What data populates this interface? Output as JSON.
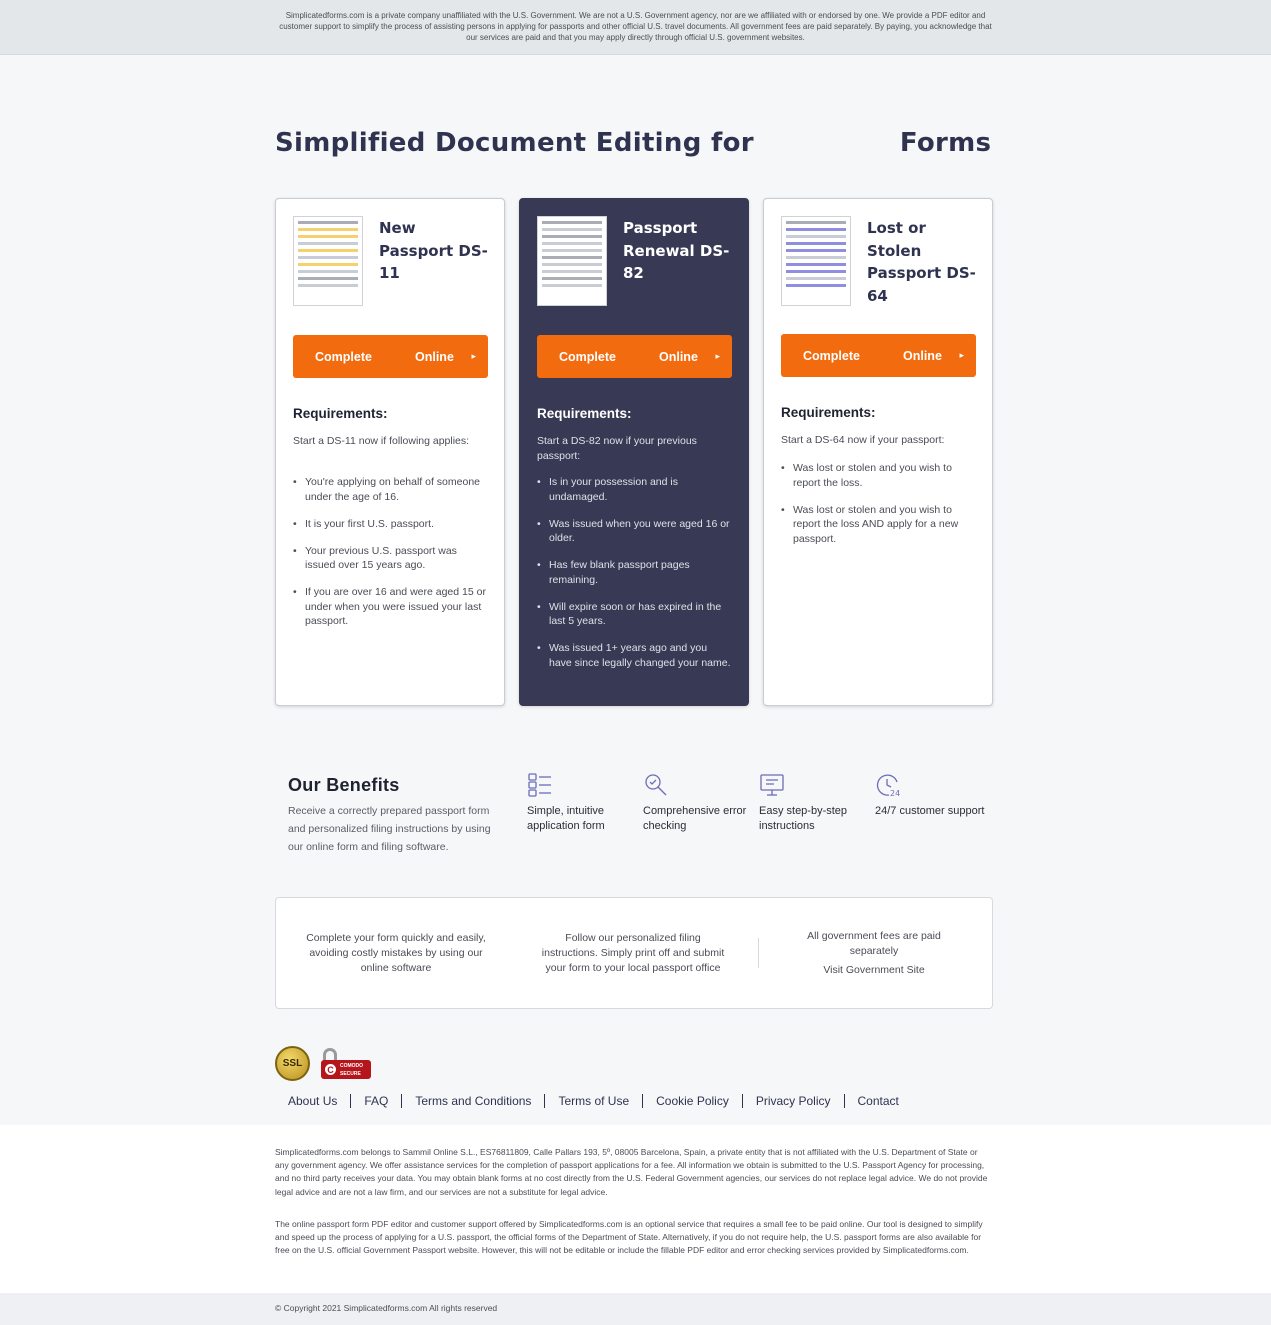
{
  "banner": {
    "text": "Simplicatedforms.com is a private company unaffiliated with the U.S. Government. We are not a U.S. Government agency, nor are we affiliated with or endorsed by one. We provide a PDF editor and customer support to simplify the process of assisting persons in applying for passports and other official U.S. travel documents. All government fees are paid separately. By paying, you acknowledge that our services are paid and that you may apply directly through official U.S. government websites."
  },
  "hero": {
    "title_left": "Simplified Document Editing for",
    "title_right": "Forms"
  },
  "cards": [
    {
      "title": "New Passport DS-11",
      "cta_word1": "Complete",
      "cta_word2": "Online",
      "cta_arrow": "▸",
      "req_title": "Requirements:",
      "req_intro": "Start a DS-11 now if following applies:",
      "items": [
        "You're applying on behalf of someone under the age of 16.",
        "It is your first U.S. passport.",
        "Your previous U.S. passport was issued over 15 years ago.",
        "If you are over 16 and were aged 15 or under when you were issued your last passport."
      ]
    },
    {
      "title": "Passport Renewal DS-82",
      "cta_word1": "Complete",
      "cta_word2": "Online",
      "cta_arrow": "▸",
      "req_title": "Requirements:",
      "req_intro": "Start a DS-82 now if your previous passport:",
      "items": [
        "Is in your possession and is undamaged.",
        "Was issued when you were aged 16 or older.",
        "Has few blank passport pages remaining.",
        "Will expire soon or has expired in the last 5 years.",
        "Was issued 1+ years ago and you have since legally changed your name."
      ]
    },
    {
      "title": "Lost or Stolen Passport DS-64",
      "cta_word1": "Complete",
      "cta_word2": "Online",
      "cta_arrow": "▸",
      "req_title": "Requirements:",
      "req_intro": "Start a DS-64 now if your passport:",
      "items": [
        "Was lost or stolen and you wish to report the loss.",
        "Was lost or stolen and you wish to report the loss AND apply for a new passport."
      ]
    }
  ],
  "benefits": {
    "title": "Our Benefits",
    "description": "Receive a correctly prepared passport form and personalized filing instructions by using our online form and filing software.",
    "items": [
      {
        "icon": "form-checklist-icon",
        "label": "Simple, intuitive application form"
      },
      {
        "icon": "magnifier-check-icon",
        "label": "Comprehensive error checking"
      },
      {
        "icon": "monitor-instructions-icon",
        "label": "Easy step-by-step instructions"
      },
      {
        "icon": "clock-24-icon",
        "label": "24/7 customer support"
      }
    ]
  },
  "info_box": {
    "col1": "Complete your form quickly and easily, avoiding costly mistakes by using our online software",
    "col2": "Follow our personalized filing instructions. Simply print off and submit your form to your local passport office",
    "col3": "All government fees are paid separately",
    "col3_link": "Visit Government Site"
  },
  "badges": {
    "ssl_label": "SSL",
    "comodo_label": "COMODO SECURE",
    "comodo_mark": "C"
  },
  "footer_nav": [
    "About Us",
    "FAQ",
    "Terms and Conditions",
    "Terms of Use",
    "Cookie Policy",
    "Privacy Policy",
    "Contact"
  ],
  "legal": {
    "p1": "Simplicatedforms.com belongs to Sammil Online S.L., ES76811809, Calle Pallars 193, 5º, 08005 Barcelona, Spain, a private entity that is not affiliated with the U.S. Department of State or any government agency. We offer assistance services for the completion of passport applications for a fee. All information we obtain is submitted to the U.S. Passport Agency for processing, and no third party receives your data. You may obtain blank forms at no cost directly from the U.S. Federal Government agencies, our services do not replace legal advice. We do not provide legal advice and are not a law firm, and our services are not a substitute for legal advice.",
    "p2": "The online passport form PDF editor and customer support offered by Simplicatedforms.com is an optional service that requires a small fee to be paid online. Our tool is designed to simplify and speed up the process of applying for a U.S. passport, the official forms of the Department of State. Alternatively, if you do not require help, the U.S. passport forms are also available for free on the U.S. official Government Passport website. However, this will not be editable or include the fillable PDF editor and error checking services provided by Simplicatedforms.com."
  },
  "copyright": "© Copyright 2021 Simplicatedforms.com All rights reserved",
  "colors": {
    "accent_orange": "#f26b0f",
    "dark_card": "#383a55",
    "heading_navy": "#2f3350",
    "icon_purple": "#6b6db8"
  }
}
